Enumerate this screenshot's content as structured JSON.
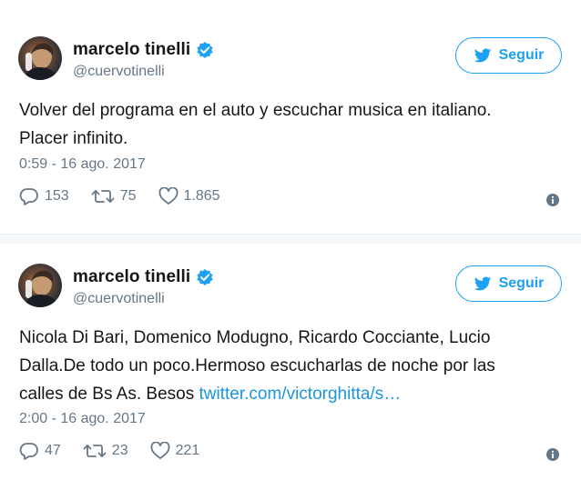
{
  "tweets": [
    {
      "author": {
        "name": "marcelo tinelli",
        "handle": "@cuervotinelli",
        "verified_icon": "verified-badge-icon"
      },
      "follow_label": "Seguir",
      "text_parts": [
        "Volver del programa en el auto y escuchar musica en italiano.",
        "Placer infinito."
      ],
      "link": "",
      "timestamp": "0:59 - 16 ago. 2017",
      "replies": "153",
      "retweets": "75",
      "likes": "1.865"
    },
    {
      "author": {
        "name": "marcelo tinelli",
        "handle": "@cuervotinelli",
        "verified_icon": "verified-badge-icon"
      },
      "follow_label": "Seguir",
      "text_parts": [
        "Nicola Di Bari, Domenico Modugno, Ricardo Cocciante, Lucio",
        "Dalla.De todo un poco.Hermoso escucharlas de noche por las",
        "calles de Bs As. Besos "
      ],
      "link": "twitter.com/victorghitta/s…",
      "timestamp": "2:00 - 16 ago. 2017",
      "replies": "47",
      "retweets": "23",
      "likes": "221"
    }
  ],
  "colors": {
    "accent": "#1da1f2",
    "link": "#1b95e0",
    "muted": "#657786",
    "text": "#14171a",
    "divider": "#e6ecf0"
  }
}
